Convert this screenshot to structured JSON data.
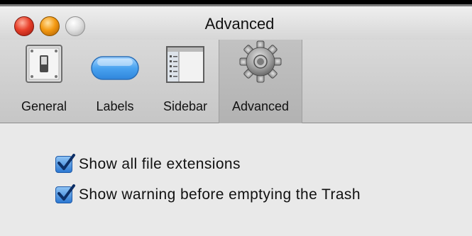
{
  "window": {
    "title": "Advanced"
  },
  "toolbar": {
    "items": [
      {
        "label": "General",
        "icon": "light-switch-icon",
        "selected": false
      },
      {
        "label": "Labels",
        "icon": "label-capsule-icon",
        "selected": false
      },
      {
        "label": "Sidebar",
        "icon": "sidebar-window-icon",
        "selected": false
      },
      {
        "label": "Advanced",
        "icon": "gear-icon",
        "selected": true
      }
    ]
  },
  "options": [
    {
      "label": "Show all file extensions",
      "checked": true
    },
    {
      "label": "Show warning before emptying the Trash",
      "checked": true
    }
  ],
  "colors": {
    "checkbox_blue": "#2c78d2",
    "label_blue": "#4aa3f0",
    "close_red": "#e8402a",
    "minimize_yellow": "#f49a12"
  }
}
